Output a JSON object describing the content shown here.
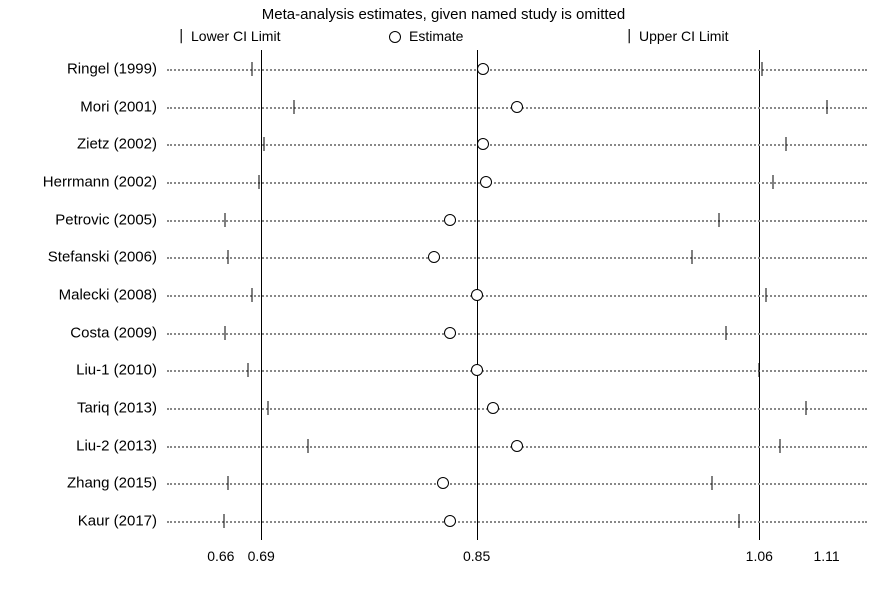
{
  "title": "Meta-analysis estimates, given named study is omitted",
  "legend": {
    "lower_ci": "Lower CI Limit",
    "estimate": "Estimate",
    "upper_ci": "Upper CI Limit"
  },
  "axis_labels": {
    "x0": "0.66",
    "x1": "0.69",
    "x2": "0.85",
    "x3": "1.06",
    "x4": "1.11"
  },
  "chart_data": {
    "type": "scatter",
    "title": "Meta-analysis estimates, given named study is omitted",
    "xlabel": "",
    "ylabel": "",
    "xlim": [
      0.62,
      1.14
    ],
    "reference_lines": [
      0.69,
      0.85,
      1.06
    ],
    "axis_ticks": [
      0.66,
      0.69,
      0.85,
      1.06,
      1.11
    ],
    "series": [
      {
        "study": "Ringel (1999)",
        "lower": 0.683,
        "estimate": 0.855,
        "upper": 1.062
      },
      {
        "study": "Mori (2001)",
        "lower": 0.714,
        "estimate": 0.88,
        "upper": 1.11
      },
      {
        "study": "Zietz (2002)",
        "lower": 0.692,
        "estimate": 0.855,
        "upper": 1.08
      },
      {
        "study": "Herrmann (2002)",
        "lower": 0.688,
        "estimate": 0.857,
        "upper": 1.07
      },
      {
        "study": "Petrovic (2005)",
        "lower": 0.663,
        "estimate": 0.83,
        "upper": 1.03
      },
      {
        "study": "Stefanski (2006)",
        "lower": 0.665,
        "estimate": 0.818,
        "upper": 1.01
      },
      {
        "study": "Malecki (2008)",
        "lower": 0.683,
        "estimate": 0.85,
        "upper": 1.065
      },
      {
        "study": "Costa (2009)",
        "lower": 0.663,
        "estimate": 0.83,
        "upper": 1.035
      },
      {
        "study": "Liu-1 (2010)",
        "lower": 0.68,
        "estimate": 0.85,
        "upper": 1.06
      },
      {
        "study": "Tariq (2013)",
        "lower": 0.695,
        "estimate": 0.862,
        "upper": 1.095
      },
      {
        "study": "Liu-2 (2013)",
        "lower": 0.725,
        "estimate": 0.88,
        "upper": 1.075
      },
      {
        "study": "Zhang (2015)",
        "lower": 0.665,
        "estimate": 0.825,
        "upper": 1.025
      },
      {
        "study": "Kaur (2017)",
        "lower": 0.662,
        "estimate": 0.83,
        "upper": 1.045
      }
    ]
  }
}
